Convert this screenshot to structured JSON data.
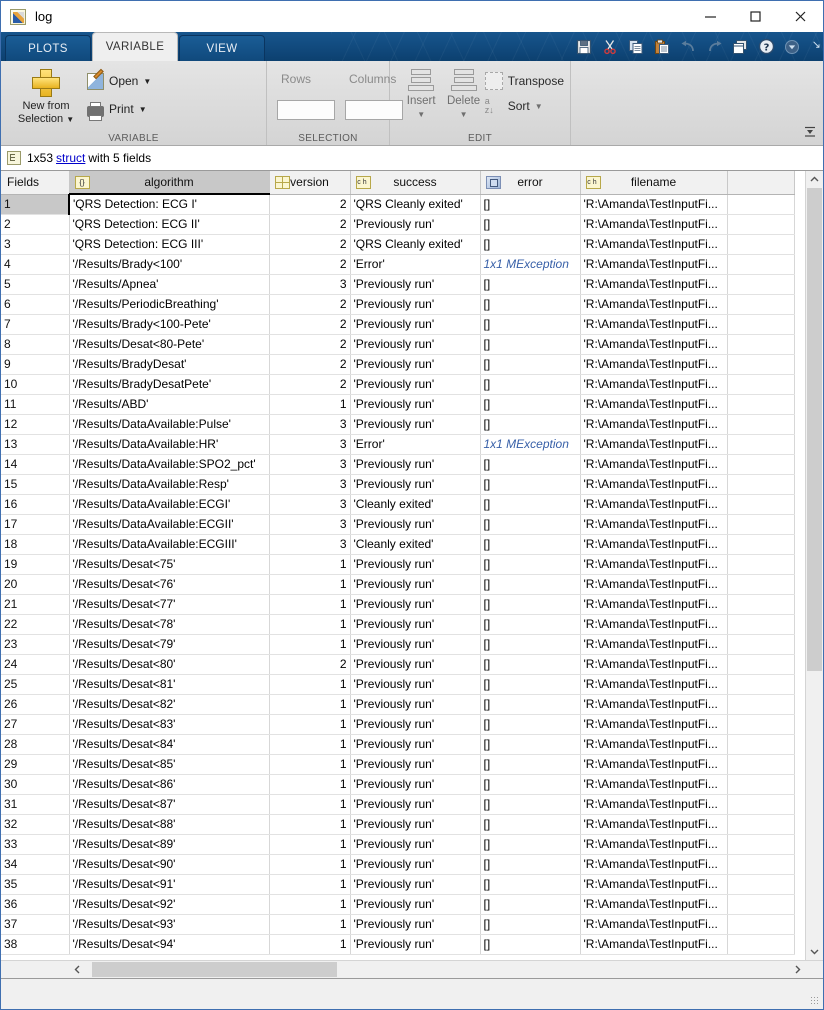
{
  "window": {
    "title": "log",
    "icon": "matlab-variable-icon",
    "controls": {
      "minimize": "minimize-icon",
      "maximize": "maximize-icon",
      "close": "close-icon"
    }
  },
  "ribbon": {
    "tabs": [
      {
        "label": "PLOTS",
        "active": false
      },
      {
        "label": "VARIABLE",
        "active": true
      },
      {
        "label": "VIEW",
        "active": false
      }
    ],
    "quick_access": [
      {
        "name": "save-icon",
        "label": "Save",
        "enabled": true
      },
      {
        "name": "cut-icon",
        "label": "Cut",
        "enabled": true
      },
      {
        "name": "copy-icon",
        "label": "Copy",
        "enabled": true
      },
      {
        "name": "paste-icon",
        "label": "Paste",
        "enabled": true
      },
      {
        "name": "undo-icon",
        "label": "Undo",
        "enabled": false
      },
      {
        "name": "redo-icon",
        "label": "Redo",
        "enabled": false
      },
      {
        "name": "cascade-windows-icon",
        "label": "Window",
        "enabled": true
      },
      {
        "name": "help-icon",
        "label": "Help",
        "enabled": true
      },
      {
        "name": "chevron-down-icon",
        "label": "More",
        "enabled": true
      }
    ],
    "groups": [
      {
        "name": "variable",
        "label": "VARIABLE",
        "new_from_selection": "New from\nSelection",
        "new_from_selection_line1": "New from",
        "new_from_selection_line2": "Selection",
        "open_label": "Open",
        "print_label": "Print"
      },
      {
        "name": "selection",
        "label": "SELECTION",
        "rows_label": "Rows",
        "columns_label": "Columns",
        "rows_value": "",
        "columns_value": ""
      },
      {
        "name": "edit",
        "label": "EDIT",
        "insert_label": "Insert",
        "delete_label": "Delete",
        "transpose_label": "Transpose",
        "sort_label": "Sort"
      }
    ]
  },
  "variable_info": {
    "prefix": "1x53",
    "link": "struct",
    "suffix": "with 5 fields",
    "icon": "struct-icon"
  },
  "table": {
    "row_header_label": "Fields",
    "columns": [
      {
        "label": "algorithm",
        "icon": "cell-array-icon",
        "icon_glyph": "{}",
        "selected": true
      },
      {
        "label": "version",
        "icon": "matrix-icon",
        "icon_glyph": "",
        "selected": false
      },
      {
        "label": "success",
        "icon": "char-icon",
        "icon_glyph": "ch",
        "selected": false
      },
      {
        "label": "error",
        "icon": "object-icon",
        "icon_glyph": "",
        "selected": false
      },
      {
        "label": "filename",
        "icon": "char-icon",
        "icon_glyph": "ch",
        "selected": false
      },
      {
        "label": "",
        "icon": "",
        "icon_glyph": "",
        "selected": false
      }
    ],
    "selected_cell": {
      "row": 1,
      "column": "algorithm"
    },
    "rows": [
      {
        "n": "1",
        "algorithm": "'QRS Detection: ECG I'",
        "version": "2",
        "success": "'QRS Cleanly exited'",
        "error": "[]",
        "filename": "'R:\\Amanda\\TestInputFi..."
      },
      {
        "n": "2",
        "algorithm": "'QRS Detection: ECG II'",
        "version": "2",
        "success": "'Previously run'",
        "error": "[]",
        "filename": "'R:\\Amanda\\TestInputFi..."
      },
      {
        "n": "3",
        "algorithm": "'QRS Detection: ECG III'",
        "version": "2",
        "success": "'QRS Cleanly exited'",
        "error": "[]",
        "filename": "'R:\\Amanda\\TestInputFi..."
      },
      {
        "n": "4",
        "algorithm": "'/Results/Brady<100'",
        "version": "2",
        "success": "'Error'",
        "error": "1x1 MException",
        "error_link": true,
        "filename": "'R:\\Amanda\\TestInputFi..."
      },
      {
        "n": "5",
        "algorithm": "'/Results/Apnea'",
        "version": "3",
        "success": "'Previously run'",
        "error": "[]",
        "filename": "'R:\\Amanda\\TestInputFi..."
      },
      {
        "n": "6",
        "algorithm": "'/Results/PeriodicBreathing'",
        "version": "2",
        "success": "'Previously run'",
        "error": "[]",
        "filename": "'R:\\Amanda\\TestInputFi..."
      },
      {
        "n": "7",
        "algorithm": "'/Results/Brady<100-Pete'",
        "version": "2",
        "success": "'Previously run'",
        "error": "[]",
        "filename": "'R:\\Amanda\\TestInputFi..."
      },
      {
        "n": "8",
        "algorithm": "'/Results/Desat<80-Pete'",
        "version": "2",
        "success": "'Previously run'",
        "error": "[]",
        "filename": "'R:\\Amanda\\TestInputFi..."
      },
      {
        "n": "9",
        "algorithm": "'/Results/BradyDesat'",
        "version": "2",
        "success": "'Previously run'",
        "error": "[]",
        "filename": "'R:\\Amanda\\TestInputFi..."
      },
      {
        "n": "10",
        "algorithm": "'/Results/BradyDesatPete'",
        "version": "2",
        "success": "'Previously run'",
        "error": "[]",
        "filename": "'R:\\Amanda\\TestInputFi..."
      },
      {
        "n": "11",
        "algorithm": "'/Results/ABD'",
        "version": "1",
        "success": "'Previously run'",
        "error": "[]",
        "filename": "'R:\\Amanda\\TestInputFi..."
      },
      {
        "n": "12",
        "algorithm": "'/Results/DataAvailable:Pulse'",
        "version": "3",
        "success": "'Previously run'",
        "error": "[]",
        "filename": "'R:\\Amanda\\TestInputFi..."
      },
      {
        "n": "13",
        "algorithm": "'/Results/DataAvailable:HR'",
        "version": "3",
        "success": "'Error'",
        "error": "1x1 MException",
        "error_link": true,
        "filename": "'R:\\Amanda\\TestInputFi..."
      },
      {
        "n": "14",
        "algorithm": "'/Results/DataAvailable:SPO2_pct'",
        "version": "3",
        "success": "'Previously run'",
        "error": "[]",
        "filename": "'R:\\Amanda\\TestInputFi..."
      },
      {
        "n": "15",
        "algorithm": "'/Results/DataAvailable:Resp'",
        "version": "3",
        "success": "'Previously run'",
        "error": "[]",
        "filename": "'R:\\Amanda\\TestInputFi..."
      },
      {
        "n": "16",
        "algorithm": "'/Results/DataAvailable:ECGI'",
        "version": "3",
        "success": "'Cleanly exited'",
        "error": "[]",
        "filename": "'R:\\Amanda\\TestInputFi..."
      },
      {
        "n": "17",
        "algorithm": "'/Results/DataAvailable:ECGII'",
        "version": "3",
        "success": "'Previously run'",
        "error": "[]",
        "filename": "'R:\\Amanda\\TestInputFi..."
      },
      {
        "n": "18",
        "algorithm": "'/Results/DataAvailable:ECGIII'",
        "version": "3",
        "success": "'Cleanly exited'",
        "error": "[]",
        "filename": "'R:\\Amanda\\TestInputFi..."
      },
      {
        "n": "19",
        "algorithm": "'/Results/Desat<75'",
        "version": "1",
        "success": "'Previously run'",
        "error": "[]",
        "filename": "'R:\\Amanda\\TestInputFi..."
      },
      {
        "n": "20",
        "algorithm": "'/Results/Desat<76'",
        "version": "1",
        "success": "'Previously run'",
        "error": "[]",
        "filename": "'R:\\Amanda\\TestInputFi..."
      },
      {
        "n": "21",
        "algorithm": "'/Results/Desat<77'",
        "version": "1",
        "success": "'Previously run'",
        "error": "[]",
        "filename": "'R:\\Amanda\\TestInputFi..."
      },
      {
        "n": "22",
        "algorithm": "'/Results/Desat<78'",
        "version": "1",
        "success": "'Previously run'",
        "error": "[]",
        "filename": "'R:\\Amanda\\TestInputFi..."
      },
      {
        "n": "23",
        "algorithm": "'/Results/Desat<79'",
        "version": "1",
        "success": "'Previously run'",
        "error": "[]",
        "filename": "'R:\\Amanda\\TestInputFi..."
      },
      {
        "n": "24",
        "algorithm": "'/Results/Desat<80'",
        "version": "2",
        "success": "'Previously run'",
        "error": "[]",
        "filename": "'R:\\Amanda\\TestInputFi..."
      },
      {
        "n": "25",
        "algorithm": "'/Results/Desat<81'",
        "version": "1",
        "success": "'Previously run'",
        "error": "[]",
        "filename": "'R:\\Amanda\\TestInputFi..."
      },
      {
        "n": "26",
        "algorithm": "'/Results/Desat<82'",
        "version": "1",
        "success": "'Previously run'",
        "error": "[]",
        "filename": "'R:\\Amanda\\TestInputFi..."
      },
      {
        "n": "27",
        "algorithm": "'/Results/Desat<83'",
        "version": "1",
        "success": "'Previously run'",
        "error": "[]",
        "filename": "'R:\\Amanda\\TestInputFi..."
      },
      {
        "n": "28",
        "algorithm": "'/Results/Desat<84'",
        "version": "1",
        "success": "'Previously run'",
        "error": "[]",
        "filename": "'R:\\Amanda\\TestInputFi..."
      },
      {
        "n": "29",
        "algorithm": "'/Results/Desat<85'",
        "version": "1",
        "success": "'Previously run'",
        "error": "[]",
        "filename": "'R:\\Amanda\\TestInputFi..."
      },
      {
        "n": "30",
        "algorithm": "'/Results/Desat<86'",
        "version": "1",
        "success": "'Previously run'",
        "error": "[]",
        "filename": "'R:\\Amanda\\TestInputFi..."
      },
      {
        "n": "31",
        "algorithm": "'/Results/Desat<87'",
        "version": "1",
        "success": "'Previously run'",
        "error": "[]",
        "filename": "'R:\\Amanda\\TestInputFi..."
      },
      {
        "n": "32",
        "algorithm": "'/Results/Desat<88'",
        "version": "1",
        "success": "'Previously run'",
        "error": "[]",
        "filename": "'R:\\Amanda\\TestInputFi..."
      },
      {
        "n": "33",
        "algorithm": "'/Results/Desat<89'",
        "version": "1",
        "success": "'Previously run'",
        "error": "[]",
        "filename": "'R:\\Amanda\\TestInputFi..."
      },
      {
        "n": "34",
        "algorithm": "'/Results/Desat<90'",
        "version": "1",
        "success": "'Previously run'",
        "error": "[]",
        "filename": "'R:\\Amanda\\TestInputFi..."
      },
      {
        "n": "35",
        "algorithm": "'/Results/Desat<91'",
        "version": "1",
        "success": "'Previously run'",
        "error": "[]",
        "filename": "'R:\\Amanda\\TestInputFi..."
      },
      {
        "n": "36",
        "algorithm": "'/Results/Desat<92'",
        "version": "1",
        "success": "'Previously run'",
        "error": "[]",
        "filename": "'R:\\Amanda\\TestInputFi..."
      },
      {
        "n": "37",
        "algorithm": "'/Results/Desat<93'",
        "version": "1",
        "success": "'Previously run'",
        "error": "[]",
        "filename": "'R:\\Amanda\\TestInputFi..."
      },
      {
        "n": "38",
        "algorithm": "'/Results/Desat<94'",
        "version": "1",
        "success": "'Previously run'",
        "error": "[]",
        "filename": "'R:\\Amanda\\TestInputFi..."
      }
    ]
  },
  "colors": {
    "ribbon_blue": "#0e4a80",
    "link_blue": "#0000cc",
    "mexception_blue": "#3860a8",
    "selection_gray": "#c8c8c8"
  }
}
